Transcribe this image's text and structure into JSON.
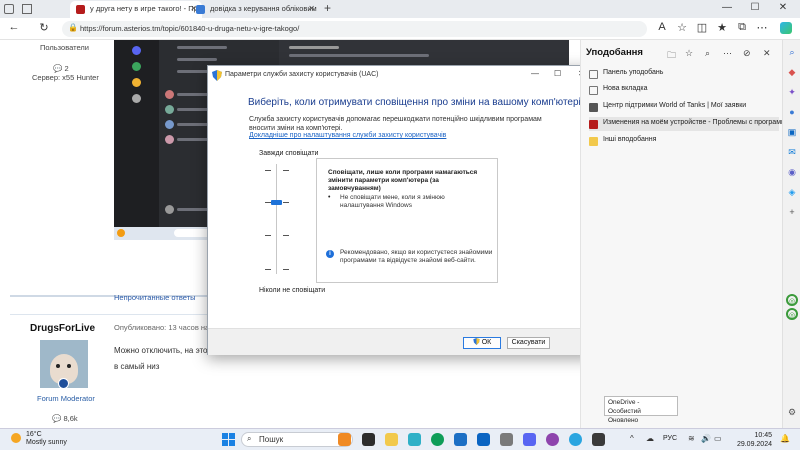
{
  "browser": {
    "tabs": [
      {
        "label": "у друга нету в игре такого! - Пр"
      },
      {
        "label": "довідка з керування обліковим"
      }
    ],
    "new_tab": "+",
    "url": "https://forum.asterios.tm/topic/601840-u-druga-netu-v-igre-takogo/"
  },
  "forum": {
    "users_label": "Пользователи",
    "likes_top": "2",
    "server_label": "Сервер: x55 Hunter",
    "unread_label": "Непрочитанные ответы",
    "author": "DrugsForLive",
    "posted_label": "Опубликовано: 13 часов на",
    "post_text_line1": "Можно отключить, на это",
    "post_text_line2": "в самый низ",
    "moderator_label": "Forum Moderator",
    "likes_bottom": "8,6k"
  },
  "uac": {
    "window_title": "Параметри служби захисту користувачів (UAC)",
    "heading": "Виберіть, коли отримувати сповіщення про зміни на вашому комп'ютері",
    "description": "Служба захисту користувачів допомагає перешкоджати потенційно шкідливим програмам вносити зміни на комп'ютері.",
    "link": "Докладніше про налаштування служби захисту користувачів",
    "always_label": "Завжди сповіщати",
    "never_label": "Ніколи не сповіщати",
    "info_heading": "Сповіщати, лише коли програми намагаються змінити параметри комп'ютера (за замовчуванням)",
    "info_bullet": "Не сповіщати мене, коли я змінюю налаштування Windows",
    "info_recommend": "Рекомендовано, якщо ви користуєтеся знайомими програмами та відвідуєте знайомі веб-сайти.",
    "ok_label": "ОК",
    "cancel_label": "Скасувати",
    "slider_level": 2,
    "slider_levels": 4
  },
  "favorites": {
    "title": "Уподобання",
    "items": [
      {
        "label": "Панель уподобань",
        "icon": "folder-icon"
      },
      {
        "label": "Нова вкладка",
        "icon": "folder-icon"
      },
      {
        "label": "Центр підтримки World of Tanks | Мої заявки",
        "icon": "wot-icon"
      },
      {
        "label": "Изменения на моём устройстве - Проблемы с программ",
        "icon": "asterios-icon",
        "selected": true
      },
      {
        "label": "Інші вподобання",
        "icon": "folder-icon"
      }
    ]
  },
  "toast": {
    "line1": "OneDrive - Особистий",
    "line2": "Оновлено"
  },
  "taskbar": {
    "temperature": "16°C",
    "weather": "Mostly sunny",
    "search_placeholder": "Пошук",
    "language": "РУС",
    "time": "10:45",
    "date": "29.09.2024"
  },
  "colors": {
    "accent": "#1d72d8",
    "heading_blue": "#1a3d8f",
    "link_blue": "#1a62c4"
  }
}
